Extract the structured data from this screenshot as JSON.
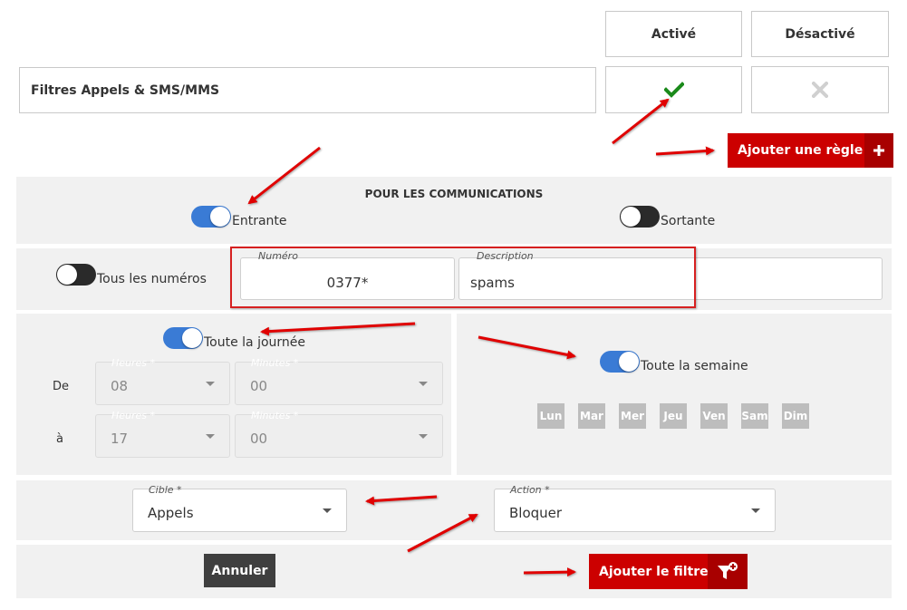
{
  "header": {
    "col_active": "Activé",
    "col_inactive": "Désactivé"
  },
  "filter_row": {
    "label": "Filtres Appels & SMS/MMS",
    "active_icon": "check-icon",
    "inactive_icon": "x-icon",
    "active": true
  },
  "add_rule_button": {
    "label": "Ajouter une règle",
    "icon": "plus-icon"
  },
  "communications": {
    "title": "POUR LES COMMUNICATIONS",
    "incoming": {
      "label": "Entrante",
      "on": true
    },
    "outgoing": {
      "label": "Sortante",
      "on": false
    }
  },
  "numbers": {
    "all_numbers": {
      "label": "Tous les numéros",
      "on": false
    },
    "number_field": {
      "legend": "Numéro",
      "value": "0377*"
    },
    "description_field": {
      "legend": "Description",
      "value": "spams"
    }
  },
  "schedule": {
    "all_day": {
      "label": "Toute la journée",
      "on": true
    },
    "from_label": "De",
    "to_label": "à",
    "from_hours": {
      "legend": "Heures *",
      "value": "08"
    },
    "from_minutes": {
      "legend": "Minutes *",
      "value": "00"
    },
    "to_hours": {
      "legend": "Heures *",
      "value": "17"
    },
    "to_minutes": {
      "legend": "Minutes *",
      "value": "00"
    }
  },
  "week": {
    "all_week": {
      "label": "Toute la semaine",
      "on": true
    },
    "days": [
      "Lun",
      "Mar",
      "Mer",
      "Jeu",
      "Ven",
      "Sam",
      "Dim"
    ]
  },
  "target": {
    "legend": "Cible *",
    "value": "Appels"
  },
  "action": {
    "legend": "Action *",
    "value": "Bloquer"
  },
  "footer": {
    "cancel_label": "Annuler",
    "add_filter_label": "Ajouter le filtre",
    "add_filter_icon": "filter-plus-icon"
  },
  "colors": {
    "brand_red": "#cc0000",
    "toggle_on": "#3a7bd5",
    "check_green": "#1a8a1a",
    "annotation_red": "#e00000"
  }
}
